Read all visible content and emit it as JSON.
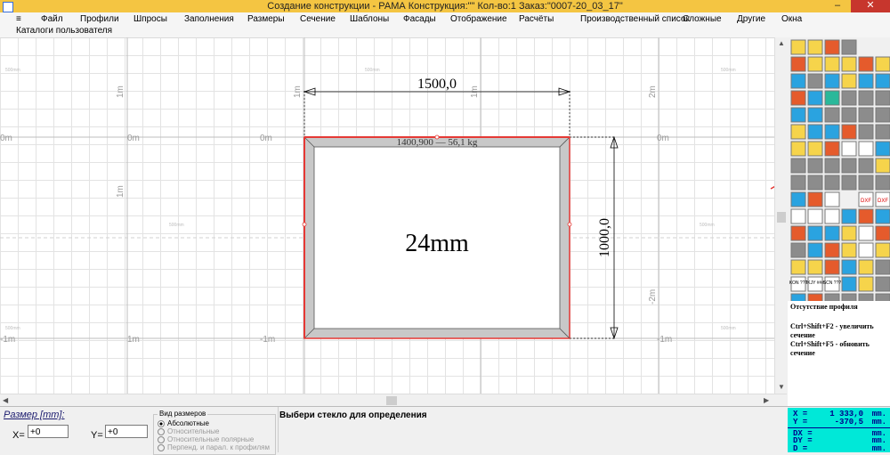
{
  "window": {
    "title": "Создание конструкции - РАМА          Конструкция:\"\" Кол-во:1  Заказ:\"0007-20_03_17\"",
    "minimize": "–",
    "maximize": "❐",
    "close": "✕"
  },
  "menu": {
    "items": [
      "≡",
      "Файл",
      "Профили",
      "Шпросы",
      "Заполнения",
      "Размеры",
      "Сечение",
      "Шаблоны",
      "Фасады",
      "Отображение",
      "Расчёты",
      "Производственный список",
      "Сложные",
      "Другие",
      "Окна"
    ],
    "second_row": "Каталоги пользователя"
  },
  "canvas": {
    "width_dimension": "1500,0",
    "height_dimension": "1000,0",
    "fill_label": "24mm",
    "frame_caption": "1400,900 — 56,1 kg",
    "axis_labels": [
      "0m",
      "0m",
      "0m",
      "0m",
      "1m",
      "1m",
      "1m",
      "1m",
      "1m",
      "1m",
      "-1m",
      "-1m",
      "-1m",
      "2m",
      "-2m"
    ],
    "ruler_labels": [
      "500mm",
      "500mm",
      "500mm",
      "500mm",
      "500mm",
      "500mm",
      "500mm",
      "500mm"
    ],
    "colors": {
      "frame_border": "#e53935",
      "frame_fill": "#c8c8c8",
      "grid": "#e3e3e3",
      "axis": "#bdbdbd",
      "arrow": "#e53935"
    }
  },
  "tools": {
    "icons": [
      "pencil-icon",
      "frame-icon",
      "profile-icon",
      "arc-icon",
      "bend-icon",
      "mullion-icon",
      "insert-icon",
      "step-icon",
      "move-icon",
      "grid-icon",
      "rotate-icon",
      "split-icon",
      "cross-icon",
      "table-icon",
      "sash-icon",
      "dim-icon",
      "door-icon",
      "magnify-icon",
      "delete-icon",
      "check-icon",
      "question-icon",
      "calc-icon",
      "color-icon",
      "dxf-import-icon",
      "dxf-export-icon",
      "zoom-in-icon",
      "zoom-out-icon",
      "chart-icon",
      "undo-icon",
      "warning-icon"
    ],
    "text_tools": [
      "KON ???",
      "IKJY ###",
      "SCN ???",
      "DXF",
      "DXF"
    ]
  },
  "hints": {
    "title": "Отсутствие профиля",
    "line1": "Ctrl+Shift+F2 - увеличить сечение",
    "line2": "Ctrl+Shift+F5 - обновить сечение"
  },
  "size": {
    "label": "Размер [mm]:",
    "x_label": "X=",
    "x_value": "+0",
    "y_label": "Y=",
    "y_value": "+0",
    "group_label": "Вид размеров",
    "options": [
      "Абсолютные",
      "Относительные",
      "Относительные полярные",
      "Перпенд. и парал. к профилям"
    ],
    "selected": 0
  },
  "status_message": "Выбери стекло для определения",
  "coordinates": {
    "x_label": "X =",
    "x_value": "1 333,0",
    "x_unit": "mm.",
    "y_label": "Y =",
    "y_value": "-370,5",
    "y_unit": "mm.",
    "dx_label": "DX =",
    "dx_unit": "mm.",
    "dy_label": "DY =",
    "dy_unit": "mm.",
    "d_label": "D =",
    "d_unit": "mm."
  }
}
